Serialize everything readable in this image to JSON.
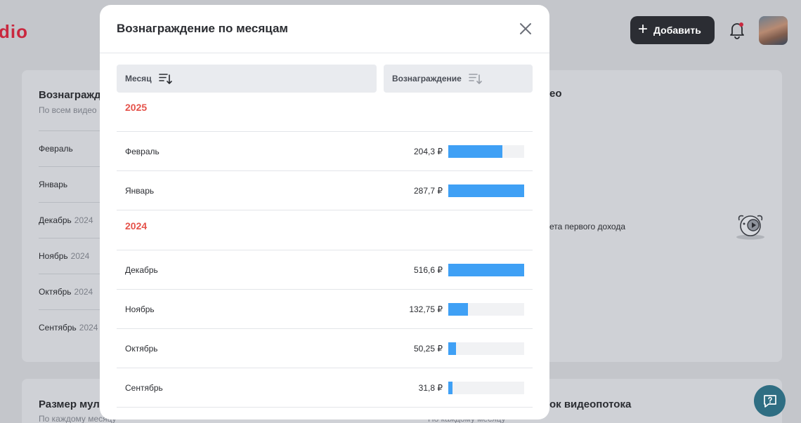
{
  "app": {
    "logo_fragment": "dio"
  },
  "header": {
    "add_button_label": "Добавить"
  },
  "background": {
    "left_card": {
      "title": "Вознагражде",
      "subtitle": "По всем видео",
      "rows": [
        {
          "month": "Февраль",
          "year": ""
        },
        {
          "month": "Январь",
          "year": ""
        },
        {
          "month": "Декабрь",
          "year": "2024"
        },
        {
          "month": "Ноябрь",
          "year": "2024"
        },
        {
          "month": "Октябрь",
          "year": "2024"
        },
        {
          "month": "Сентябрь",
          "year": "2024"
        }
      ]
    },
    "right_card": {
      "title": "ео",
      "empty_text": "ета первого дохода"
    },
    "bottom_left_card": {
      "title": "Размер муль",
      "subtitle": "По каждому месяцу"
    },
    "bottom_right_card": {
      "title": "ок видеопотока",
      "subtitle": "По каждому месяцу"
    }
  },
  "modal": {
    "title": "Вознаграждение по месяцам",
    "columns": {
      "month": "Месяц",
      "reward": "Вознаграждение"
    },
    "groups": [
      {
        "year": "2025",
        "rows": [
          {
            "month": "Февраль",
            "amount": "204,3 ₽",
            "fill": 0.71
          },
          {
            "month": "Январь",
            "amount": "287,7 ₽",
            "fill": 1.0
          }
        ]
      },
      {
        "year": "2024",
        "rows": [
          {
            "month": "Декабрь",
            "amount": "516,6 ₽",
            "fill": 1.0
          },
          {
            "month": "Ноябрь",
            "amount": "132,75 ₽",
            "fill": 0.26
          },
          {
            "month": "Октябрь",
            "amount": "50,25 ₽",
            "fill": 0.1
          },
          {
            "month": "Сентябрь",
            "amount": "31,8 ₽",
            "fill": 0.06
          }
        ]
      }
    ],
    "bar_color": "#3fa0f5",
    "year_color": "#e5534b"
  }
}
